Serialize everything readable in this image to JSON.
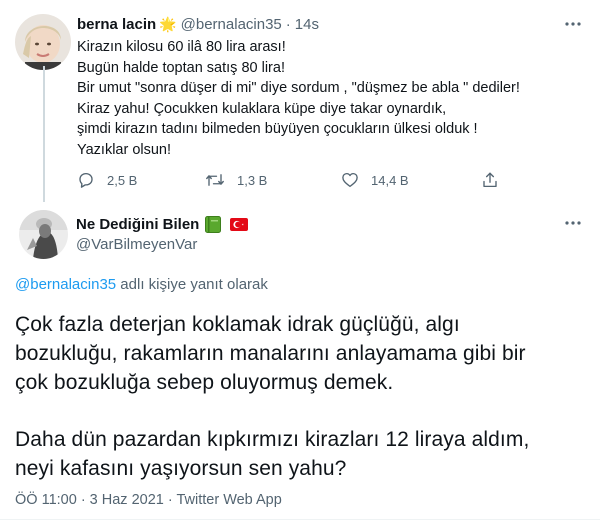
{
  "quoted_tweet": {
    "author_name": "berna lacin",
    "verified_emoji": "🌟",
    "handle": "@bernalacin35",
    "separator": "·",
    "time": "14s",
    "lines": [
      "Kirazın kilosu 60 ilâ 80 lira arası!",
      "Bugün halde toptan satış 80 lira!",
      "Bir umut \"sonra düşer di mi\" diye sordum , \"düşmez be abla \" dediler!",
      "Kiraz yahu! Çocukken kulaklara küpe diye takar oynardık,",
      "şimdi kirazın tadını bilmeden büyüyen çocukların ülkesi olduk !",
      "Yazıklar olsun!"
    ],
    "actions": {
      "reply_count": "2,5 B",
      "retweet_count": "1,3 B",
      "like_count": "14,4 B"
    }
  },
  "main_tweet": {
    "author_name": "Ne Dediğini Bilen",
    "handle": "@VarBilmeyenVar",
    "replying_to_handle": "@bernalacin35",
    "replying_suffix": " adlı kişiye yanıt olarak",
    "paragraph1": [
      "Çok fazla deterjan koklamak idrak güçlüğü, algı",
      "bozukluğu, rakamların manalarını anlayamama gibi bir",
      "çok bozukluğa sebep oluyormuş demek."
    ],
    "paragraph2": [
      "Daha dün pazardan kıpkırmızı kirazları 12 liraya aldım,",
      "neyi kafasını yaşıyorsun sen yahu?"
    ],
    "meta": "ÖÖ 11:00 · 3 Haz 2021 · Twitter Web App"
  },
  "colors": {
    "accent": "#1d9bf0",
    "secondary_text": "#536471",
    "primary_text": "#0f1419",
    "thread_line": "#cfd9de",
    "flag_red": "#e30a17"
  },
  "icons": [
    "more-icon",
    "reply-icon",
    "retweet-icon",
    "like-icon",
    "share-icon",
    "green-book-icon",
    "turkey-flag-icon"
  ]
}
